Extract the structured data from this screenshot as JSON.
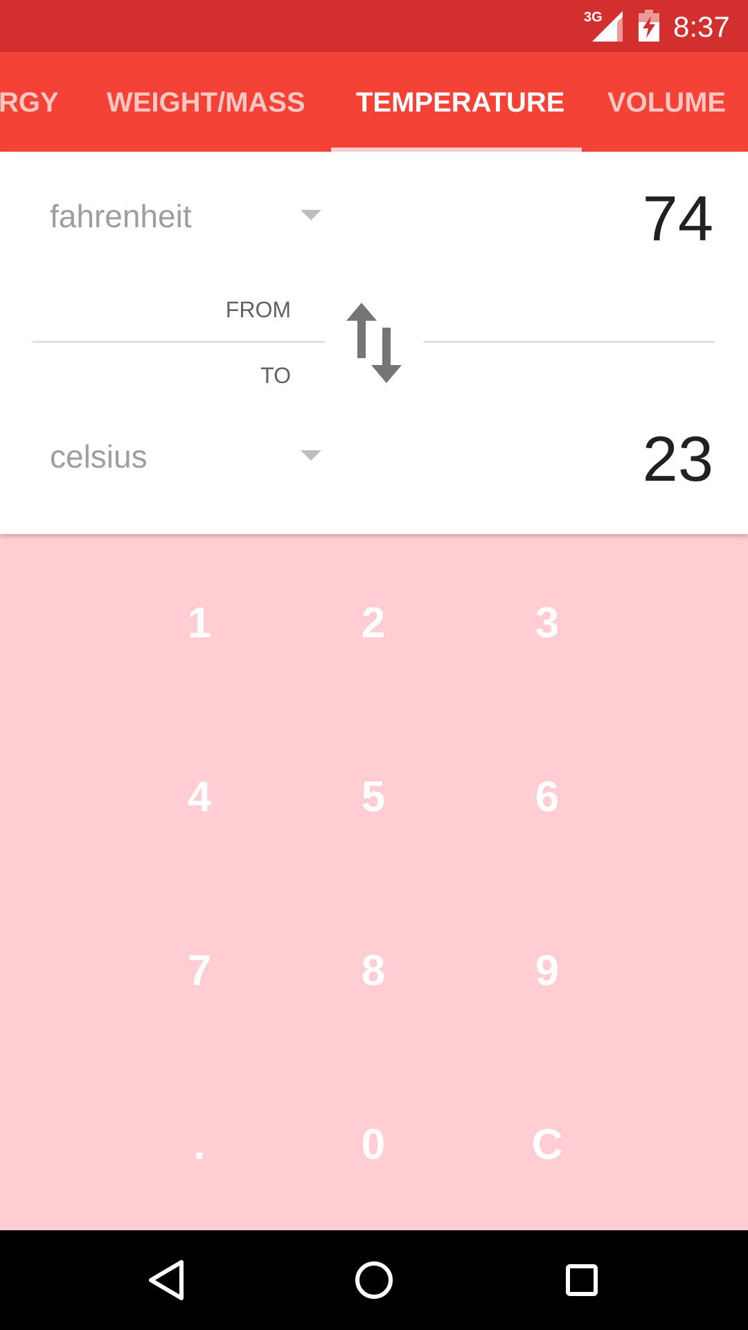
{
  "status_bar": {
    "network_type": "3G",
    "signal_icon": "cellular-signal-icon",
    "battery_icon": "battery-charging-icon",
    "time": "8:37",
    "background_color": "#d32f2f"
  },
  "tabs": [
    {
      "label": "RGY",
      "active": false
    },
    {
      "label": "WEIGHT/MASS",
      "active": false
    },
    {
      "label": "TEMPERATURE",
      "active": true
    },
    {
      "label": "VOLUME",
      "active": false
    }
  ],
  "tab_bar_color": "#f44336",
  "converter": {
    "from_unit": "fahrenheit",
    "from_value": "74",
    "from_label": "FROM",
    "to_label": "TO",
    "to_unit": "celsius",
    "to_value": "23",
    "swap_icon": "swap-vertical-icon",
    "dropdown_icon": "dropdown-arrow-icon"
  },
  "keypad": {
    "keys": [
      "1",
      "2",
      "3",
      "4",
      "5",
      "6",
      "7",
      "8",
      "9",
      ".",
      "0",
      "C"
    ],
    "background_color": "#ffcdd2"
  },
  "nav_bar": {
    "back_icon": "back-triangle-icon",
    "home_icon": "home-circle-icon",
    "recents_icon": "recents-square-icon"
  }
}
